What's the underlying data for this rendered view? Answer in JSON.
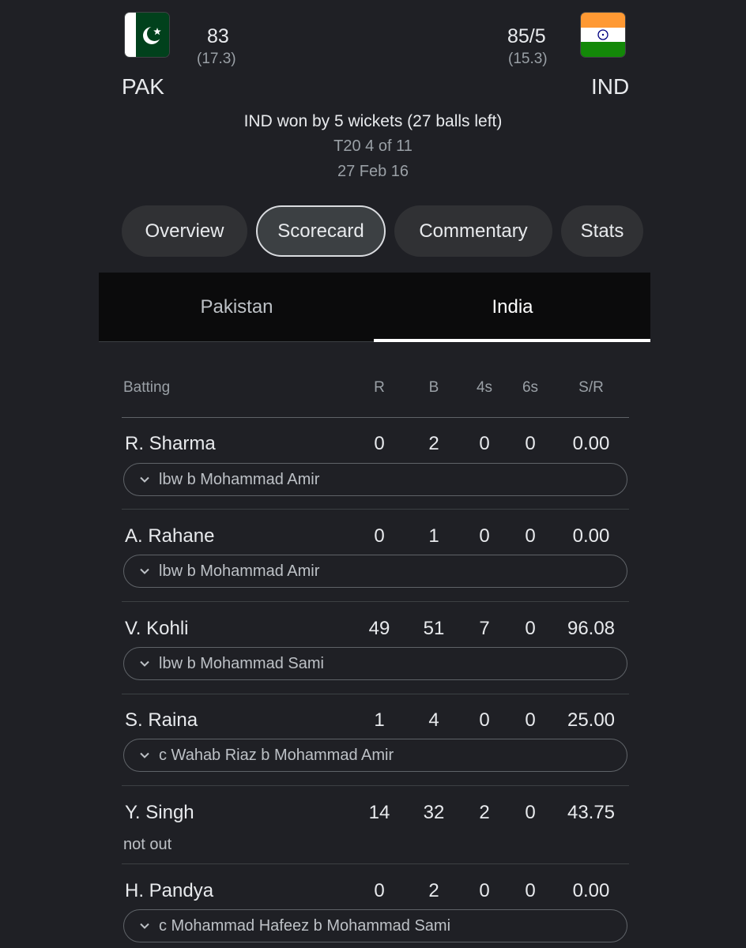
{
  "match": {
    "team1": {
      "code": "PAK",
      "score": "83",
      "overs": "(17.3)",
      "flag_icon": "pakistan-flag-icon"
    },
    "team2": {
      "code": "IND",
      "score": "85/5",
      "overs": "(15.3)",
      "flag_icon": "india-flag-icon"
    },
    "result": "IND won by 5 wickets (27 balls left)",
    "series": "T20 4 of 11",
    "date": "27 Feb 16"
  },
  "chips": [
    "Overview",
    "Scorecard",
    "Commentary",
    "Stats"
  ],
  "active_chip": "Scorecard",
  "team_tabs": [
    "Pakistan",
    "India"
  ],
  "active_team_tab": "India",
  "batting": {
    "headers": [
      "Batting",
      "R",
      "B",
      "4s",
      "6s",
      "S/R"
    ],
    "rows": [
      {
        "name": "R. Sharma",
        "r": "0",
        "b": "2",
        "fours": "0",
        "sixes": "0",
        "sr": "0.00",
        "dismissal": "lbw b Mohammad Amir"
      },
      {
        "name": "A. Rahane",
        "r": "0",
        "b": "1",
        "fours": "0",
        "sixes": "0",
        "sr": "0.00",
        "dismissal": "lbw b Mohammad Amir"
      },
      {
        "name": "V. Kohli",
        "r": "49",
        "b": "51",
        "fours": "7",
        "sixes": "0",
        "sr": "96.08",
        "dismissal": "lbw b Mohammad Sami"
      },
      {
        "name": "S. Raina",
        "r": "1",
        "b": "4",
        "fours": "0",
        "sixes": "0",
        "sr": "25.00",
        "dismissal": "c Wahab Riaz b Mohammad Amir"
      },
      {
        "name": "Y. Singh",
        "r": "14",
        "b": "32",
        "fours": "2",
        "sixes": "0",
        "sr": "43.75",
        "dismissal": "not out"
      },
      {
        "name": "H. Pandya",
        "r": "0",
        "b": "2",
        "fours": "0",
        "sixes": "0",
        "sr": "0.00",
        "dismissal": "c Mohammad Hafeez b Mohammad Sami"
      }
    ]
  },
  "colors": {
    "background": "#1f2025",
    "chip": "#303134",
    "tab_bar": "#0b0b0c",
    "pak_green": "#01411c",
    "ind_saffron": "#ff9933",
    "ind_green": "#138808",
    "chakra": "#000080"
  }
}
